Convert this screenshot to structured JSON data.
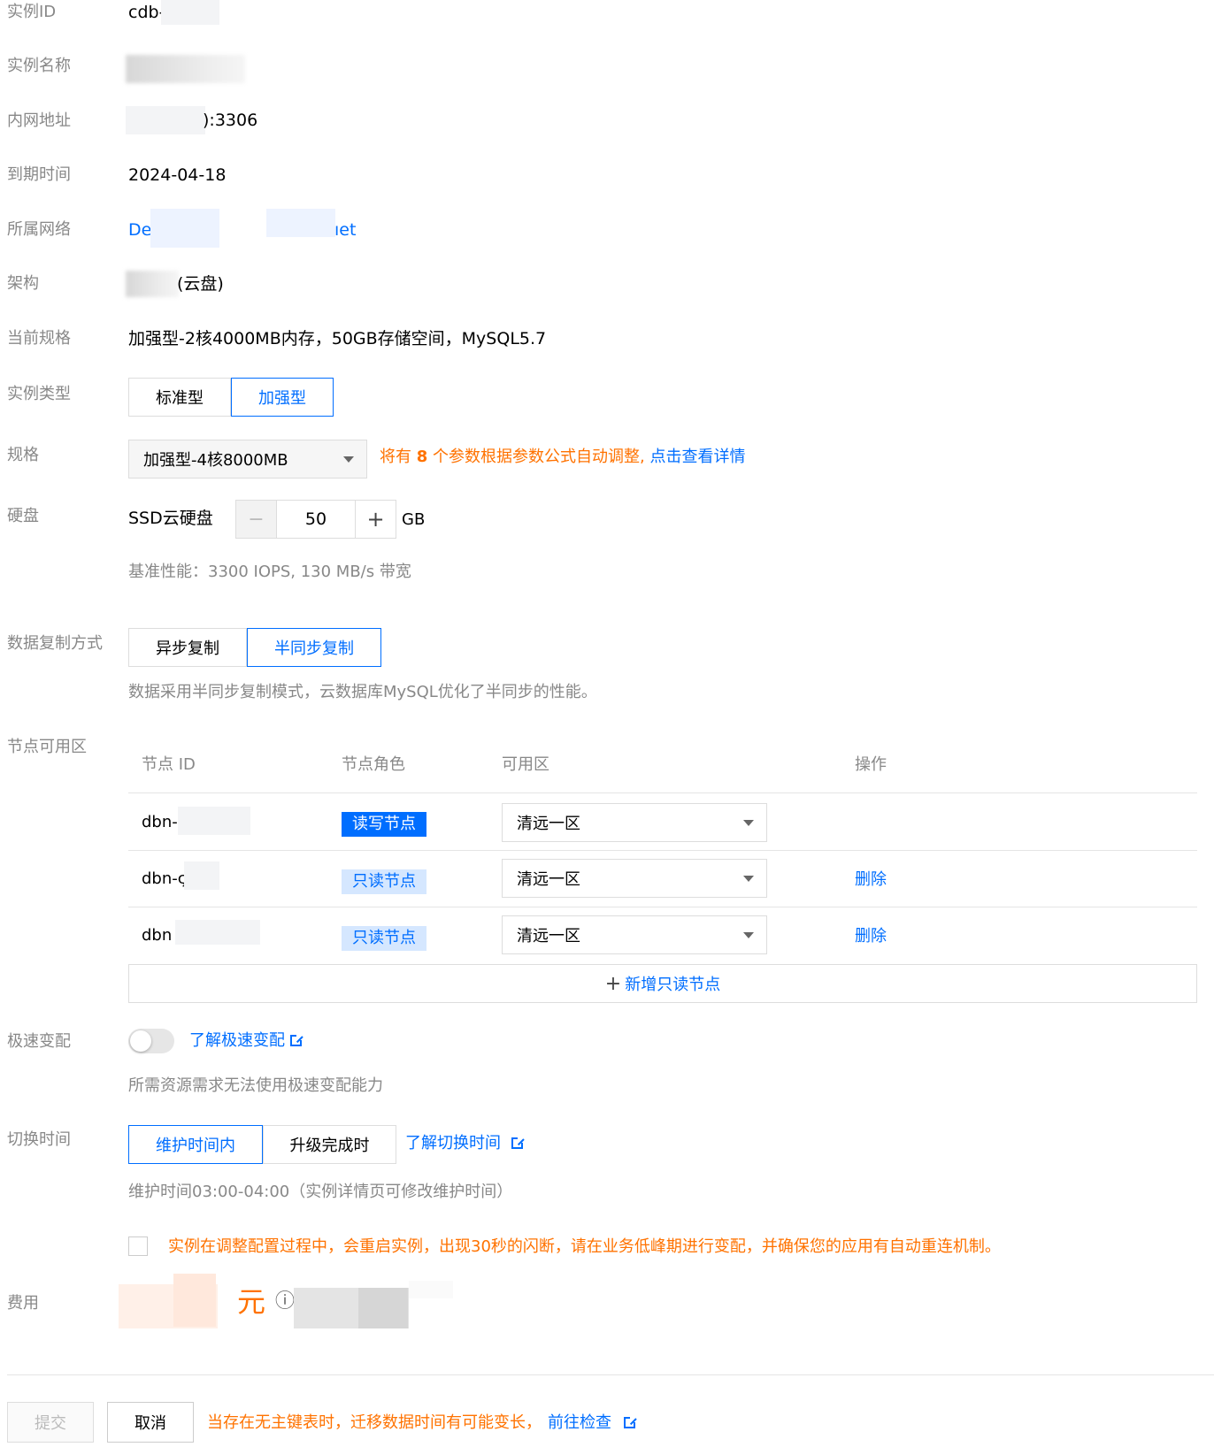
{
  "labels": {
    "instance_id": "实例ID",
    "instance_name": "实例名称",
    "private_address": "内网地址",
    "expire_time": "到期时间",
    "network": "所属网络",
    "architecture": "架构",
    "current_spec": "当前规格",
    "instance_type": "实例类型",
    "spec": "规格",
    "disk": "硬盘",
    "replication": "数据复制方式",
    "node_zone": "节点可用区",
    "fast_change": "极速变配",
    "switch_time": "切换时间",
    "cost": "费用"
  },
  "values": {
    "instance_id": "cdb-",
    "private_address": "):3306",
    "expire_time": "2024-04-18",
    "network_prefix": "De",
    "network_suffix": "ıet",
    "architecture": "(云盘)",
    "current_spec": "加强型-2核4000MB内存，50GB存储空间，MySQL5.7"
  },
  "instance_type": {
    "options": [
      "标准型",
      "加强型"
    ],
    "selected": "加强型"
  },
  "spec": {
    "selected": "加强型-4核8000MB",
    "notice_prefix": "将有",
    "notice_count": "8",
    "notice_middle": "个参数根据参数公式自动调整,",
    "notice_link": "点击查看详情"
  },
  "disk": {
    "type": "SSD云硬盘",
    "value": "50",
    "unit": "GB",
    "perf": "基准性能：3300 IOPS, 130 MB/s 带宽",
    "minus": "−",
    "plus": "+"
  },
  "replication": {
    "options": [
      "异步复制",
      "半同步复制"
    ],
    "selected": "半同步复制",
    "desc": "数据采用半同步复制模式，云数据库MySQL优化了半同步的性能。"
  },
  "nodes": {
    "headers": [
      "节点 ID",
      "节点角色",
      "可用区",
      "操作"
    ],
    "rows": [
      {
        "id": "dbn-",
        "role": "读写节点",
        "zone": "清远一区",
        "action": ""
      },
      {
        "id": "dbn-ς",
        "role": "只读节点",
        "zone": "清远一区",
        "action": "删除"
      },
      {
        "id": "dbn",
        "role": "只读节点",
        "zone": "清远一区",
        "action": "删除"
      }
    ],
    "add": "新增只读节点",
    "add_icon": "+"
  },
  "fast_change": {
    "link": "了解极速变配",
    "desc": "所需资源需求无法使用极速变配能力",
    "enabled": false
  },
  "switch_time": {
    "options": [
      "维护时间内",
      "升级完成时"
    ],
    "selected": "维护时间内",
    "link": "了解切换时间",
    "desc": "维护时间03:00-04:00（实例详情页可修改维护时间）"
  },
  "warning": "实例在调整配置过程中，会重启实例，出现30秒的闪断，请在业务低峰期进行变配，并确保您的应用有自动重连机制。",
  "cost": {
    "unit": "元",
    "info_icon": "ⓘ"
  },
  "footer": {
    "submit": "提交",
    "cancel": "取消",
    "notice": "当存在无主键表时，迁移数据时间有可能变长，",
    "link": "前往检查"
  },
  "colors": {
    "primary": "#006eff",
    "warning": "#ff7200",
    "label": "#888888"
  }
}
